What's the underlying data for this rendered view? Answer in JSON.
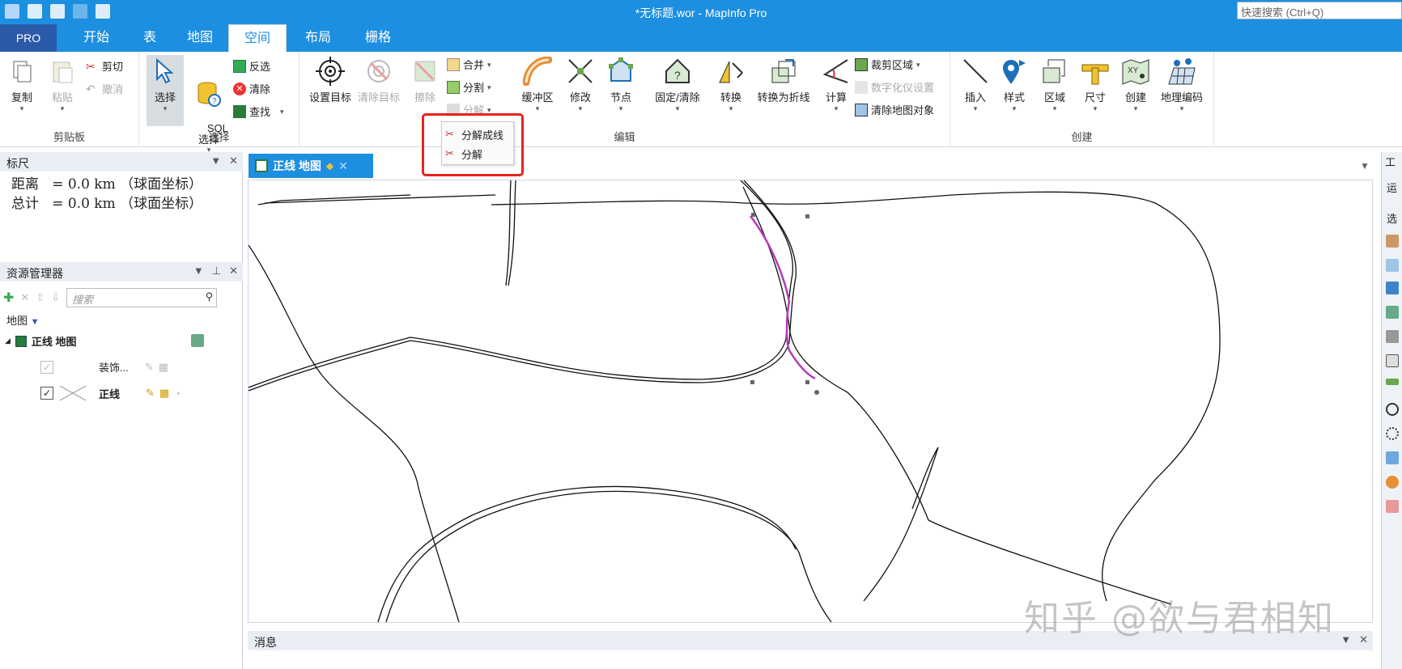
{
  "window": {
    "title": "*无标题.wor - MapInfo Pro",
    "quick_search_placeholder": "快速搜索 (Ctrl+Q)"
  },
  "tabs": [
    {
      "label": "PRO"
    },
    {
      "label": "开始"
    },
    {
      "label": "表"
    },
    {
      "label": "地图"
    },
    {
      "label": "空间",
      "active": true
    },
    {
      "label": "布局"
    },
    {
      "label": "栅格"
    }
  ],
  "ribbon": {
    "clipboard": {
      "label": "剪贴板",
      "copy": "复制",
      "paste": "粘贴",
      "cut": "剪切",
      "undo": "撤消"
    },
    "select": {
      "label": "选择",
      "select": "选择",
      "sql_select": "SQL\n选择",
      "invert": "反选",
      "clear": "清除",
      "find": "查找"
    },
    "edit": {
      "label": "编辑",
      "set_target": "设置目标",
      "clear_target": "清除目标",
      "erase": "擦除",
      "combine": "合并",
      "split": "分割",
      "disaggregate": "分解",
      "buffer": "缓冲区",
      "modify": "修改",
      "nodes": "节点",
      "snap_clean": "固定/清除",
      "convert": "转换",
      "convert_polyline": "转换为折线",
      "calculate": "计算",
      "clip_region": "裁剪区域",
      "digitizer_setup": "数字化仪设置",
      "clear_map_objects": "清除地图对象"
    },
    "create": {
      "label": "创建",
      "insert": "插入",
      "style": "样式",
      "region": "区域",
      "dimension": "尺寸",
      "create": "创建",
      "geocode": "地理编码"
    }
  },
  "dropdown": {
    "items": [
      "分解成线",
      "分解"
    ]
  },
  "ruler_panel": {
    "title": "标尺",
    "lines": [
      "距离   = 0.0 km （球面坐标）",
      "总计   = 0.0 km （球面坐标）"
    ]
  },
  "explorer": {
    "title": "资源管理器",
    "search_placeholder": "搜索",
    "group": "地图",
    "map_name": "正线 地图",
    "layers": [
      {
        "name": "装饰...",
        "checked": true,
        "dim": true
      },
      {
        "name": "正线",
        "checked": true,
        "dim": false
      }
    ]
  },
  "document": {
    "tab_label": "正线 地图"
  },
  "messages": {
    "title": "消息"
  },
  "right_panel": {
    "tab1": "工",
    "tab2": "运",
    "tab3": "选"
  },
  "watermark": "知乎 @欲与君相知",
  "colors": {
    "accent": "#1d8fe0",
    "pro_tab": "#2b5aa8",
    "highlight": "#e8231c",
    "selected_line": "#b63ab8"
  }
}
